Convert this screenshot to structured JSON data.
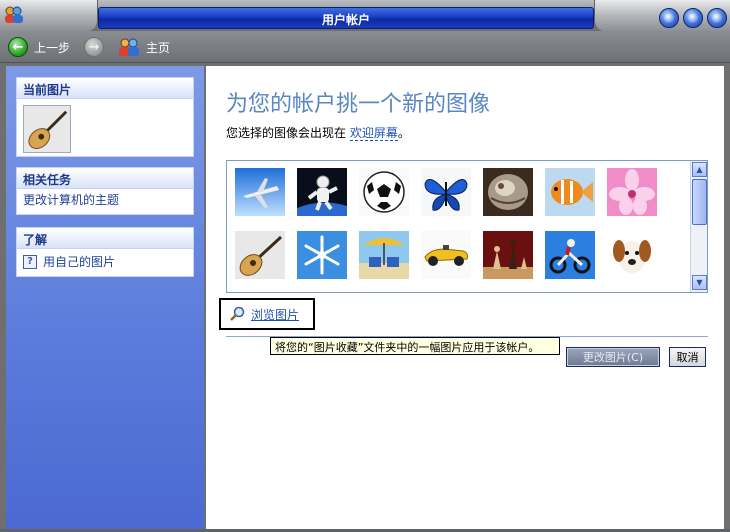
{
  "window": {
    "title": "用户帐户"
  },
  "toolbar": {
    "back_label": "上一步",
    "home_label": "主页"
  },
  "sidebar": {
    "current_picture": {
      "heading": "当前图片"
    },
    "related_tasks": {
      "heading": "相关任务",
      "items": [
        "更改计算机的主题"
      ]
    },
    "learn_about": {
      "heading": "了解",
      "items": [
        "用自己的图片"
      ]
    }
  },
  "main": {
    "title": "为您的帐户挑一个新的图像",
    "description_prefix": "您选择的图像会出现在 ",
    "description_link": "欢迎屏幕",
    "description_suffix": "。",
    "pictures": [
      "airplane",
      "astronaut",
      "soccer-ball",
      "butterfly",
      "fossil",
      "fish",
      "flower",
      "guitar",
      "snowflake",
      "beach-chairs",
      "race-car",
      "chess",
      "motorbike",
      "dog"
    ],
    "browse_label": "浏览图片",
    "tooltip": "将您的“图片收藏”文件夹中的一幅图片应用于该帐户。",
    "change_button": "更改图片(C)",
    "cancel_button": "取消"
  },
  "colors": {
    "title_blue": "#1b3ec6",
    "sidebar_blue": "#5a7bdb",
    "heading_blue": "#5a86c2",
    "link_blue": "#1d52b8"
  }
}
